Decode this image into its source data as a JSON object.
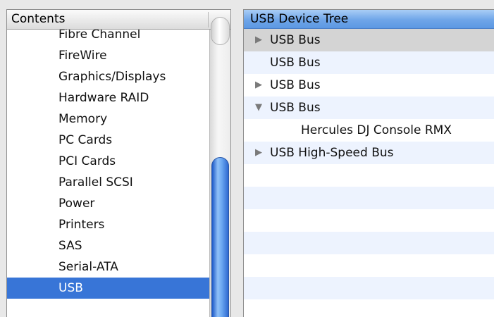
{
  "contents_panel": {
    "header": "Contents",
    "items": [
      {
        "label": "Fibre Channel",
        "selected": false
      },
      {
        "label": "FireWire",
        "selected": false
      },
      {
        "label": "Graphics/Displays",
        "selected": false
      },
      {
        "label": "Hardware RAID",
        "selected": false
      },
      {
        "label": "Memory",
        "selected": false
      },
      {
        "label": "PC Cards",
        "selected": false
      },
      {
        "label": "PCI Cards",
        "selected": false
      },
      {
        "label": "Parallel SCSI",
        "selected": false
      },
      {
        "label": "Power",
        "selected": false
      },
      {
        "label": "Printers",
        "selected": false
      },
      {
        "label": "SAS",
        "selected": false
      },
      {
        "label": "Serial-ATA",
        "selected": false
      },
      {
        "label": "USB",
        "selected": true
      }
    ]
  },
  "device_tree": {
    "header": "USB Device Tree",
    "rows": [
      {
        "label": "USB Bus",
        "toggle": "collapsed",
        "depth": 0,
        "highlighted": true
      },
      {
        "label": "USB Bus",
        "toggle": "none",
        "depth": 0,
        "highlighted": false
      },
      {
        "label": "USB Bus",
        "toggle": "collapsed",
        "depth": 0,
        "highlighted": false
      },
      {
        "label": "USB Bus",
        "toggle": "expanded",
        "depth": 0,
        "highlighted": false
      },
      {
        "label": "Hercules DJ Console RMX",
        "toggle": "none",
        "depth": 1,
        "highlighted": false
      },
      {
        "label": "USB High-Speed Bus",
        "toggle": "collapsed",
        "depth": 0,
        "highlighted": false
      }
    ]
  },
  "colors": {
    "selection": "#3875d7",
    "tree_header": "#6fa5e8",
    "row_stripe": "#edf3fe",
    "row_highlight": "#d4d4d4"
  },
  "icons": {
    "collapsed": "disclosure-triangle-right-icon",
    "expanded": "disclosure-triangle-down-icon"
  }
}
